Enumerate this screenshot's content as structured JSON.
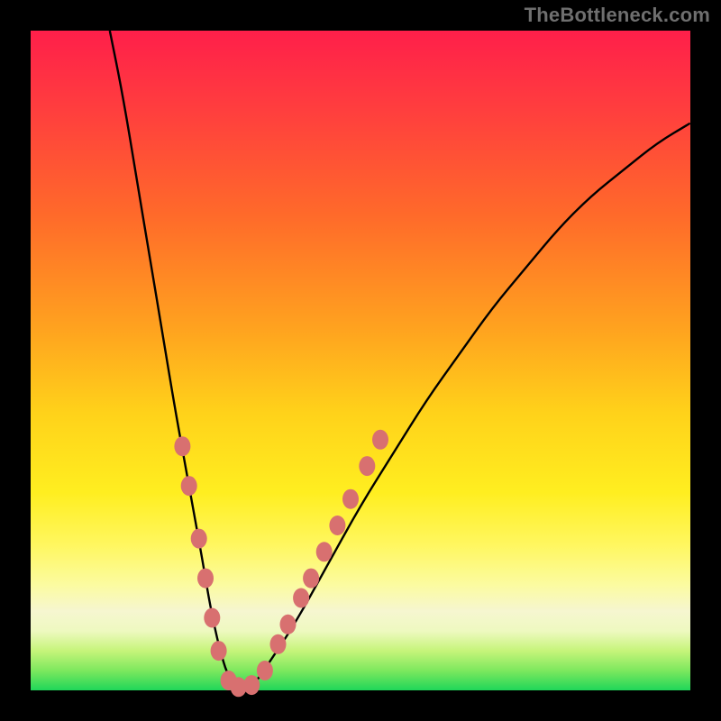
{
  "watermark_text": "TheBottleneck.com",
  "colors": {
    "frame": "#000000",
    "dot": "#d87070",
    "curve": "#000000",
    "gradient_stops": [
      "#ff1f4a",
      "#ff3e3e",
      "#ff6a2a",
      "#ffa21f",
      "#ffd21a",
      "#ffee20",
      "#fff760",
      "#fbfba0",
      "#f6f6d0",
      "#eef9c0",
      "#c6f47a",
      "#7de85e",
      "#1fd659"
    ]
  },
  "chart_data": {
    "type": "line",
    "title": "",
    "xlabel": "",
    "ylabel": "",
    "xlim": [
      0,
      100
    ],
    "ylim": [
      0,
      100
    ],
    "grid": false,
    "legend": "none",
    "series": [
      {
        "name": "bottleneck-curve",
        "x": [
          12,
          14,
          16,
          18,
          20,
          22,
          24,
          26,
          27,
          28,
          29,
          30,
          32,
          34,
          36,
          40,
          45,
          50,
          55,
          60,
          65,
          70,
          75,
          80,
          85,
          90,
          95,
          100
        ],
        "y": [
          100,
          90,
          78,
          66,
          54,
          42,
          31,
          20,
          14,
          9,
          5,
          2,
          0.5,
          1,
          4,
          10,
          19,
          28,
          36,
          44,
          51,
          58,
          64,
          70,
          75,
          79,
          83,
          86
        ]
      }
    ],
    "points": [
      {
        "name": "left-dot-1",
        "x": 23.0,
        "y": 37
      },
      {
        "name": "left-dot-2",
        "x": 24.0,
        "y": 31
      },
      {
        "name": "left-dot-3",
        "x": 25.5,
        "y": 23
      },
      {
        "name": "left-dot-4",
        "x": 26.5,
        "y": 17
      },
      {
        "name": "left-dot-5",
        "x": 27.5,
        "y": 11
      },
      {
        "name": "left-dot-6",
        "x": 28.5,
        "y": 6
      },
      {
        "name": "bottom-dot-1",
        "x": 30.0,
        "y": 1.5
      },
      {
        "name": "bottom-dot-2",
        "x": 31.5,
        "y": 0.5
      },
      {
        "name": "bottom-dot-3",
        "x": 33.5,
        "y": 0.8
      },
      {
        "name": "bottom-dot-4",
        "x": 35.5,
        "y": 3
      },
      {
        "name": "right-dot-1",
        "x": 37.5,
        "y": 7
      },
      {
        "name": "right-dot-2",
        "x": 39.0,
        "y": 10
      },
      {
        "name": "right-dot-3",
        "x": 41.0,
        "y": 14
      },
      {
        "name": "right-dot-4",
        "x": 42.5,
        "y": 17
      },
      {
        "name": "right-dot-5",
        "x": 44.5,
        "y": 21
      },
      {
        "name": "right-dot-6",
        "x": 46.5,
        "y": 25
      },
      {
        "name": "right-dot-7",
        "x": 48.5,
        "y": 29
      },
      {
        "name": "right-dot-8",
        "x": 51.0,
        "y": 34
      },
      {
        "name": "right-dot-9",
        "x": 53.0,
        "y": 38
      }
    ]
  }
}
